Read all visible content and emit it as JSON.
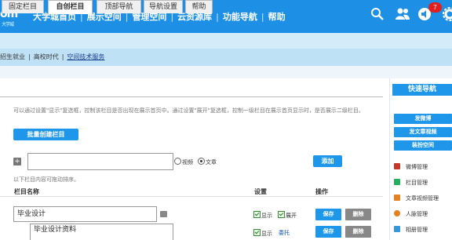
{
  "header": {
    "logo_text": "om",
    "logo_sub": "大学城",
    "nav": [
      "大学城首页",
      "展示空间",
      "管理空间",
      "云资源库",
      "功能导航",
      "帮助"
    ],
    "nav_separator": "|",
    "notification_count": "7",
    "icons": [
      "search-icon",
      "users-icon",
      "message-icon",
      "gear-icon"
    ]
  },
  "breadcrumb": {
    "items": [
      "招生就业",
      "高校时代",
      "空间技术服务"
    ],
    "separator": "|"
  },
  "tabs": [
    "固定栏目",
    "自创栏目",
    "顶部导航",
    "导航设置",
    "帮助"
  ],
  "active_tab": 1,
  "description": "可以通过设置\"显示\"复选框，控制该栏目是否出现在展示首页中。通过设置\"展开\"复选框，控制一级栏目在展示首页显示时，是否展示二级栏目。",
  "batch_create_label": "批量创建栏目",
  "new_column": {
    "value": "",
    "radio_video": "视频",
    "radio_text": "文章",
    "add_label": "添加"
  },
  "drag_hint": "以下栏目内容可拖动排序。",
  "table": {
    "headers": [
      "栏目名称",
      "设置",
      "操作"
    ],
    "rows": [
      {
        "name": "毕业设计",
        "show": "显示",
        "expand": "展开",
        "save": "保存",
        "delete": "删除"
      },
      {
        "name": "毕业设计资料",
        "show": "显示",
        "entrust": "委托",
        "save": "保存",
        "delete": "删除"
      }
    ]
  },
  "quick_nav": {
    "title": "快速导航",
    "buttons": [
      "发微博",
      "发文章视频",
      "装扮空间"
    ],
    "menu": [
      {
        "label": "微博管理",
        "icon": "weibo-icon",
        "color": "#c0392b"
      },
      {
        "label": "栏目管理",
        "icon": "columns-icon",
        "color": "#27ae60"
      },
      {
        "label": "文章视频管理",
        "icon": "article-icon",
        "color": "#e67e22"
      },
      {
        "label": "人脉管理",
        "icon": "contacts-icon",
        "color": "#e67e22"
      },
      {
        "label": "相册管理",
        "icon": "album-icon",
        "color": "#3498db"
      }
    ]
  },
  "colors": {
    "brand": "#1d90e6",
    "button": "#1e97ea",
    "delete": "#888888"
  }
}
